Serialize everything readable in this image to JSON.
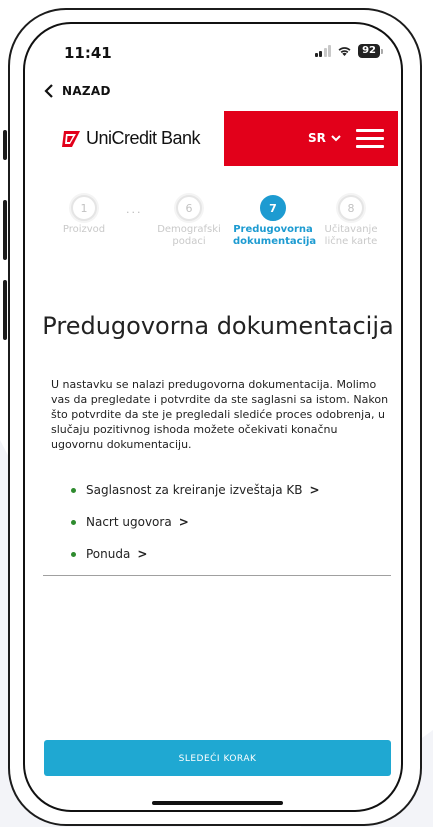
{
  "status_bar": {
    "time": "11:41",
    "battery": "92"
  },
  "nav": {
    "back_label": "NAZAD"
  },
  "header": {
    "brand_name": "UniCredit Bank",
    "language": "SR",
    "brand_color": "#e2001a"
  },
  "stepper": {
    "steps": [
      {
        "number": "1",
        "label_line1": "Proizvod",
        "label_line2": ""
      },
      {
        "number": "6",
        "label_line1": "Demografski",
        "label_line2": "podaci"
      },
      {
        "number": "7",
        "label_line1": "Predugovorna",
        "label_line2": "dokumentacija"
      },
      {
        "number": "8",
        "label_line1": "Učitavanje",
        "label_line2": "lične karte"
      }
    ],
    "ellipsis": "...",
    "active_color": "#1d9bd1"
  },
  "main": {
    "title": "Predugovorna dokumentacija",
    "intro": "U nastavku se nalazi predugovorna dokumentacija. Molimo vas da pregledate i potvrdite da ste saglasni sa istom. Nakon što potvrdite da ste je pregledali slediće proces odobrenja, u slučaju pozitivnog ishoda možete očekivati konačnu ugovornu dokumentaciju.",
    "links": [
      {
        "label": "Saglasnost za kreiranje izveštaja KB",
        "arrow": ">"
      },
      {
        "label": "Nacrt ugovora",
        "arrow": ">"
      },
      {
        "label": "Ponuda",
        "arrow": ">"
      }
    ]
  },
  "footer": {
    "next_label": "SLEDEĆI KORAK",
    "button_color": "#1fa8d2"
  }
}
